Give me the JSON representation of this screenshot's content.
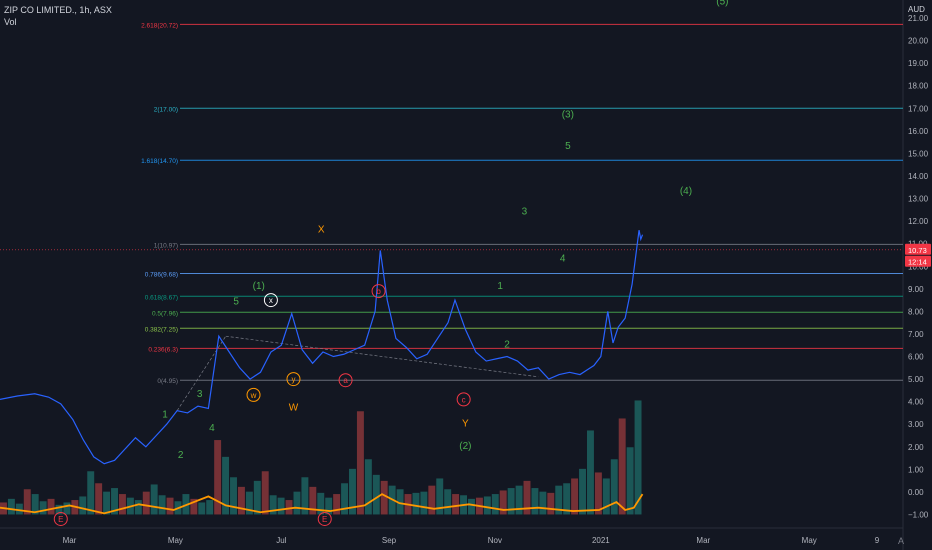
{
  "header": {
    "symbol": "ZIP CO LIMITED., 1h, ASX",
    "indicator": "Vol",
    "currency": "AUD",
    "corner": "A"
  },
  "colors": {
    "background": "#131722",
    "price_line": "#2962ff",
    "up_bar": "#26a69a",
    "down_bar": "#ef5350",
    "vol_ma": "#ff9800"
  },
  "chart_data": {
    "type": "line",
    "y_ticks": [
      "21.00",
      "20.00",
      "19.00",
      "18.00",
      "17.00",
      "16.00",
      "15.00",
      "14.00",
      "13.00",
      "12.00",
      "11.00",
      "10.00",
      "9.00",
      "8.00",
      "7.00",
      "6.00",
      "5.00",
      "4.00",
      "3.00",
      "2.00",
      "1.00",
      "0.00",
      "−1.00"
    ],
    "x_ticks": [
      {
        "label": "Mar",
        "day": 0
      },
      {
        "label": "May",
        "day": 61
      },
      {
        "label": "Jul",
        "day": 122
      },
      {
        "label": "Sep",
        "day": 184
      },
      {
        "label": "Nov",
        "day": 245
      },
      {
        "label": "2021",
        "day": 306
      },
      {
        "label": "Mar",
        "day": 365
      },
      {
        "label": "May",
        "day": 426
      },
      {
        "label": "9",
        "day": 465
      }
    ],
    "ylim": [
      -1.6,
      21.8
    ],
    "xlim_days": [
      -40,
      480
    ],
    "price": {
      "name": "ZIP",
      "points": [
        [
          -40,
          4.1
        ],
        [
          -30,
          4.25
        ],
        [
          -20,
          4.35
        ],
        [
          -12,
          4.2
        ],
        [
          -5,
          3.9
        ],
        [
          2,
          3.2
        ],
        [
          8,
          2.3
        ],
        [
          14,
          1.55
        ],
        [
          20,
          1.25
        ],
        [
          26,
          1.4
        ],
        [
          32,
          1.9
        ],
        [
          38,
          2.4
        ],
        [
          44,
          2.0
        ],
        [
          50,
          2.5
        ],
        [
          56,
          3.0
        ],
        [
          62,
          3.6
        ],
        [
          68,
          3.5
        ],
        [
          74,
          3.8
        ],
        [
          80,
          3.7
        ],
        [
          86,
          6.9
        ],
        [
          92,
          6.2
        ],
        [
          98,
          5.5
        ],
        [
          104,
          5.0
        ],
        [
          110,
          5.3
        ],
        [
          116,
          6.2
        ],
        [
          122,
          6.5
        ],
        [
          128,
          7.9
        ],
        [
          134,
          6.3
        ],
        [
          140,
          5.7
        ],
        [
          146,
          6.2
        ],
        [
          152,
          6.0
        ],
        [
          158,
          6.1
        ],
        [
          164,
          6.3
        ],
        [
          170,
          6.5
        ],
        [
          176,
          8.0
        ],
        [
          179,
          10.7
        ],
        [
          183,
          8.5
        ],
        [
          188,
          6.8
        ],
        [
          194,
          6.4
        ],
        [
          200,
          5.9
        ],
        [
          206,
          6.1
        ],
        [
          212,
          6.8
        ],
        [
          218,
          7.5
        ],
        [
          222,
          8.5
        ],
        [
          228,
          7.2
        ],
        [
          234,
          6.2
        ],
        [
          240,
          5.8
        ],
        [
          246,
          5.9
        ],
        [
          252,
          6.0
        ],
        [
          258,
          5.8
        ],
        [
          264,
          5.4
        ],
        [
          270,
          5.5
        ],
        [
          276,
          5.0
        ],
        [
          282,
          5.2
        ],
        [
          288,
          5.3
        ],
        [
          294,
          5.2
        ],
        [
          298,
          5.4
        ],
        [
          302,
          5.6
        ],
        [
          306,
          6.0
        ],
        [
          310,
          8.0
        ],
        [
          313,
          6.6
        ],
        [
          316,
          7.3
        ],
        [
          320,
          7.7
        ],
        [
          324,
          9.2
        ],
        [
          328,
          11.6
        ],
        [
          329,
          11.2
        ],
        [
          330,
          11.4
        ]
      ]
    },
    "volume": [
      0.1,
      0.13,
      0.09,
      0.21,
      0.17,
      0.11,
      0.13,
      0.08,
      0.1,
      0.12,
      0.15,
      0.36,
      0.26,
      0.19,
      0.22,
      0.17,
      0.14,
      0.12,
      0.19,
      0.25,
      0.16,
      0.14,
      0.11,
      0.17,
      0.13,
      0.1,
      0.12,
      0.62,
      0.48,
      0.31,
      0.23,
      0.19,
      0.28,
      0.36,
      0.16,
      0.14,
      0.12,
      0.19,
      0.31,
      0.23,
      0.18,
      0.14,
      0.17,
      0.26,
      0.38,
      0.86,
      0.46,
      0.33,
      0.28,
      0.24,
      0.21,
      0.17,
      0.18,
      0.19,
      0.24,
      0.3,
      0.21,
      0.17,
      0.16,
      0.13,
      0.14,
      0.15,
      0.17,
      0.2,
      0.22,
      0.24,
      0.28,
      0.22,
      0.19,
      0.18,
      0.24,
      0.26,
      0.3,
      0.38,
      0.7,
      0.35,
      0.3,
      0.46,
      0.8,
      0.56,
      0.95
    ],
    "vol_ma": [
      [
        -40,
        -0.7
      ],
      [
        -20,
        -0.9
      ],
      [
        0,
        -0.6
      ],
      [
        20,
        -0.95
      ],
      [
        40,
        -0.55
      ],
      [
        60,
        -0.8
      ],
      [
        80,
        -0.2
      ],
      [
        90,
        -0.6
      ],
      [
        110,
        -0.9
      ],
      [
        130,
        -0.7
      ],
      [
        150,
        -0.85
      ],
      [
        170,
        -0.6
      ],
      [
        180,
        -0.1
      ],
      [
        190,
        -0.5
      ],
      [
        210,
        -0.75
      ],
      [
        230,
        -0.55
      ],
      [
        250,
        -0.8
      ],
      [
        270,
        -0.7
      ],
      [
        290,
        -0.85
      ],
      [
        305,
        -0.8
      ],
      [
        315,
        -0.45
      ],
      [
        320,
        -0.8
      ],
      [
        325,
        -0.7
      ],
      [
        330,
        -0.1
      ]
    ]
  },
  "price_tags": [
    {
      "label": "10.73",
      "price": 10.73,
      "color": "#f23645"
    },
    {
      "label": "12:14",
      "price": 10.2,
      "color": "#f23645"
    }
  ],
  "fib_levels": [
    {
      "label": "2.618(20.72)",
      "price": 20.72,
      "color": "#f23645"
    },
    {
      "label": "2(17.00)",
      "price": 17.0,
      "color": "#2ab1c6"
    },
    {
      "label": "1.618(14.70)",
      "price": 14.7,
      "color": "#2196f3"
    },
    {
      "label": "1(10.97)",
      "price": 10.97,
      "color": "#787b86"
    },
    {
      "label": "0.786(9.68)",
      "price": 9.68,
      "color": "#5b9cf6"
    },
    {
      "label": "0.618(8.67)",
      "price": 8.67,
      "color": "#089981"
    },
    {
      "label": "0.5(7.96)",
      "price": 7.96,
      "color": "#4caf50"
    },
    {
      "label": "0.382(7.25)",
      "price": 7.25,
      "color": "#8bc34a"
    },
    {
      "label": "0.236(6.3)",
      "price": 6.36,
      "color": "#f23645"
    },
    {
      "label": "0(4.95)",
      "price": 4.95,
      "color": "#787b86"
    }
  ],
  "wave_labels": [
    {
      "text": "(5)",
      "day": 376,
      "price": 21.6,
      "color": "#4caf50"
    },
    {
      "text": "(3)",
      "day": 287,
      "price": 16.6,
      "color": "#4caf50"
    },
    {
      "text": "5",
      "day": 287,
      "price": 15.2,
      "color": "#4caf50"
    },
    {
      "text": "(4)",
      "day": 355,
      "price": 13.2,
      "color": "#4caf50"
    },
    {
      "text": "3",
      "day": 262,
      "price": 12.3,
      "color": "#4caf50"
    },
    {
      "text": "X",
      "day": 145,
      "price": 11.5,
      "color": "#ff9800"
    },
    {
      "text": "4",
      "day": 284,
      "price": 10.2,
      "color": "#4caf50"
    },
    {
      "text": "1",
      "day": 248,
      "price": 9.0,
      "color": "#4caf50"
    },
    {
      "text": "(1)",
      "day": 109,
      "price": 9.0,
      "color": "#4caf50"
    },
    {
      "text": "5",
      "day": 96,
      "price": 8.3,
      "color": "#4caf50"
    },
    {
      "text": "2",
      "day": 252,
      "price": 6.4,
      "color": "#4caf50"
    },
    {
      "text": "3",
      "day": 75,
      "price": 4.2,
      "color": "#4caf50"
    },
    {
      "text": "W",
      "day": 129,
      "price": 3.6,
      "color": "#ff9800"
    },
    {
      "text": "1",
      "day": 55,
      "price": 3.3,
      "color": "#4caf50"
    },
    {
      "text": "4",
      "day": 82,
      "price": 2.7,
      "color": "#4caf50"
    },
    {
      "text": "Y",
      "day": 228,
      "price": 2.9,
      "color": "#ff9800"
    },
    {
      "text": "2",
      "day": 64,
      "price": 1.5,
      "color": "#4caf50"
    },
    {
      "text": "(2)",
      "day": 228,
      "price": 1.9,
      "color": "#4caf50"
    }
  ],
  "circle_labels": [
    {
      "text": "x",
      "day": 116,
      "price": 8.5,
      "color": "#ffffff"
    },
    {
      "text": "b",
      "day": 178,
      "price": 8.9,
      "color": "#f23645"
    },
    {
      "text": "y",
      "day": 129,
      "price": 5.0,
      "color": "#ff9800"
    },
    {
      "text": "a",
      "day": 159,
      "price": 4.95,
      "color": "#f23645"
    },
    {
      "text": "w",
      "day": 106,
      "price": 4.3,
      "color": "#ff9800"
    },
    {
      "text": "c",
      "day": 227,
      "price": 4.1,
      "color": "#f23645"
    },
    {
      "text": "E",
      "day": -5,
      "price": -1.2,
      "color": "#f23645"
    },
    {
      "text": "E",
      "day": 147,
      "price": -1.2,
      "color": "#f23645"
    }
  ]
}
